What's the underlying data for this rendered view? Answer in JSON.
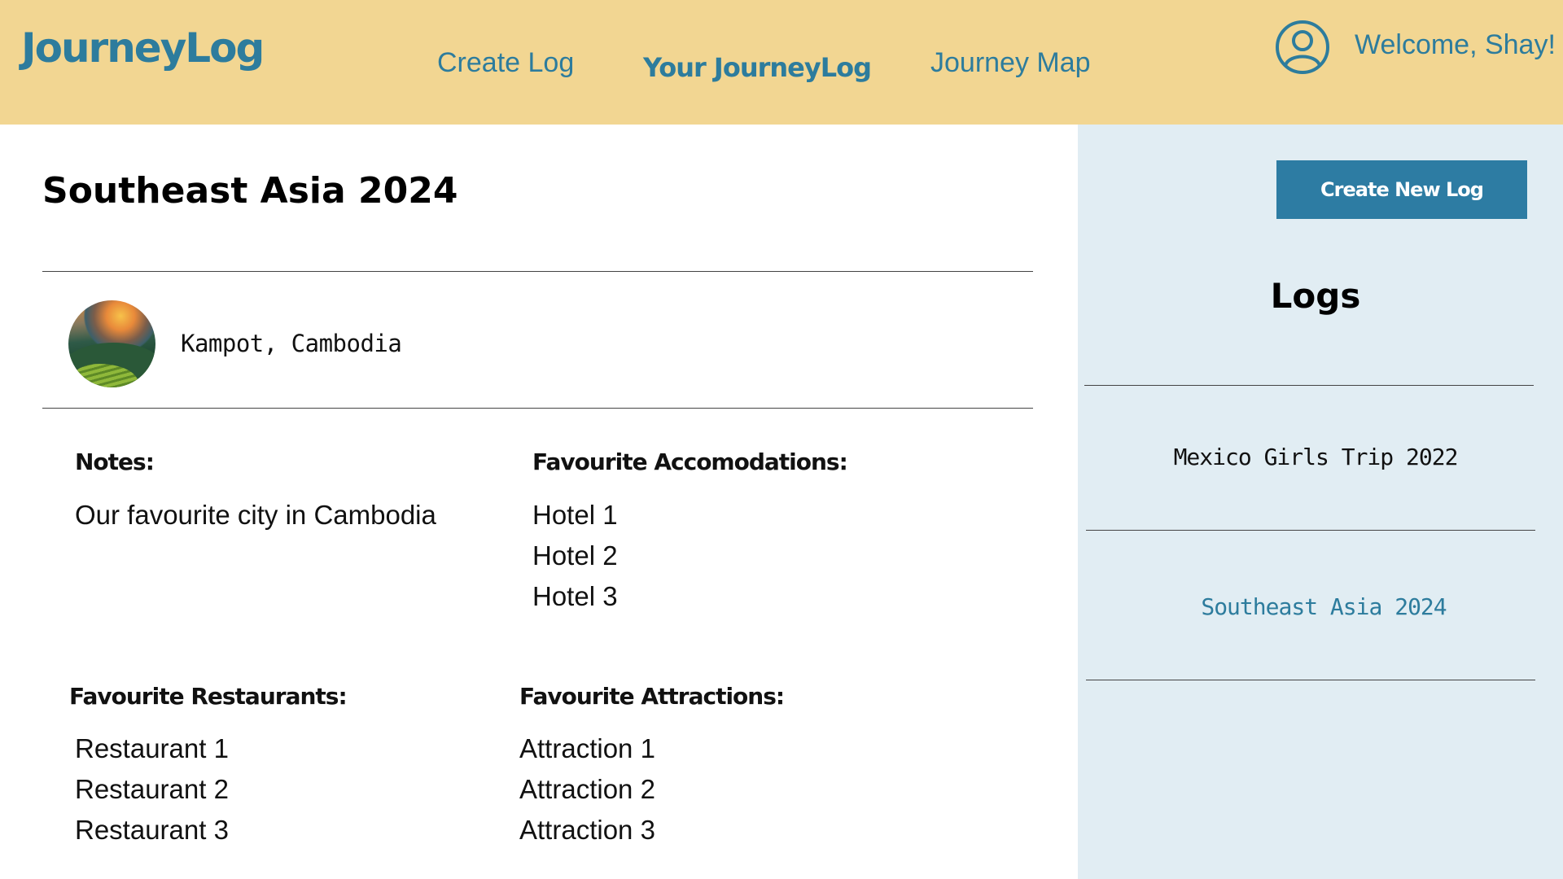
{
  "header": {
    "logo": "JourneyLog",
    "nav": [
      {
        "label": "Create Log"
      },
      {
        "label": "Your JourneyLog"
      },
      {
        "label": "Journey Map"
      }
    ],
    "welcome": "Welcome, Shay!",
    "user_icon": "user-circle-icon"
  },
  "main": {
    "title": "Southeast Asia 2024",
    "location": {
      "name": "Kampot, Cambodia",
      "image_icon": "landscape-photo"
    },
    "notes": {
      "label": "Notes:",
      "text": "Our favourite city in Cambodia"
    },
    "accommodations": {
      "label": "Favourite Accomodations:",
      "items": [
        "Hotel 1",
        "Hotel 2",
        "Hotel 3"
      ]
    },
    "restaurants": {
      "label": "Favourite Restaurants:",
      "items": [
        "Restaurant 1",
        "Restaurant 2",
        "Restaurant 3"
      ]
    },
    "attractions": {
      "label": "Favourite Attractions:",
      "items": [
        "Attraction 1",
        "Attraction 2",
        "Attraction 3"
      ]
    }
  },
  "sidebar": {
    "create_button": "Create New Log",
    "logs_title": "Logs",
    "logs": [
      {
        "label": "Mexico Girls Trip 2022",
        "active": false
      },
      {
        "label": "Southeast Asia 2024",
        "active": true
      }
    ]
  },
  "colors": {
    "header_bg": "#F2D692",
    "brand": "#2D7C9D",
    "sidebar_bg": "#E1EDF3",
    "button_bg": "#2D7CA3",
    "active_log": "#2D7C9D"
  }
}
